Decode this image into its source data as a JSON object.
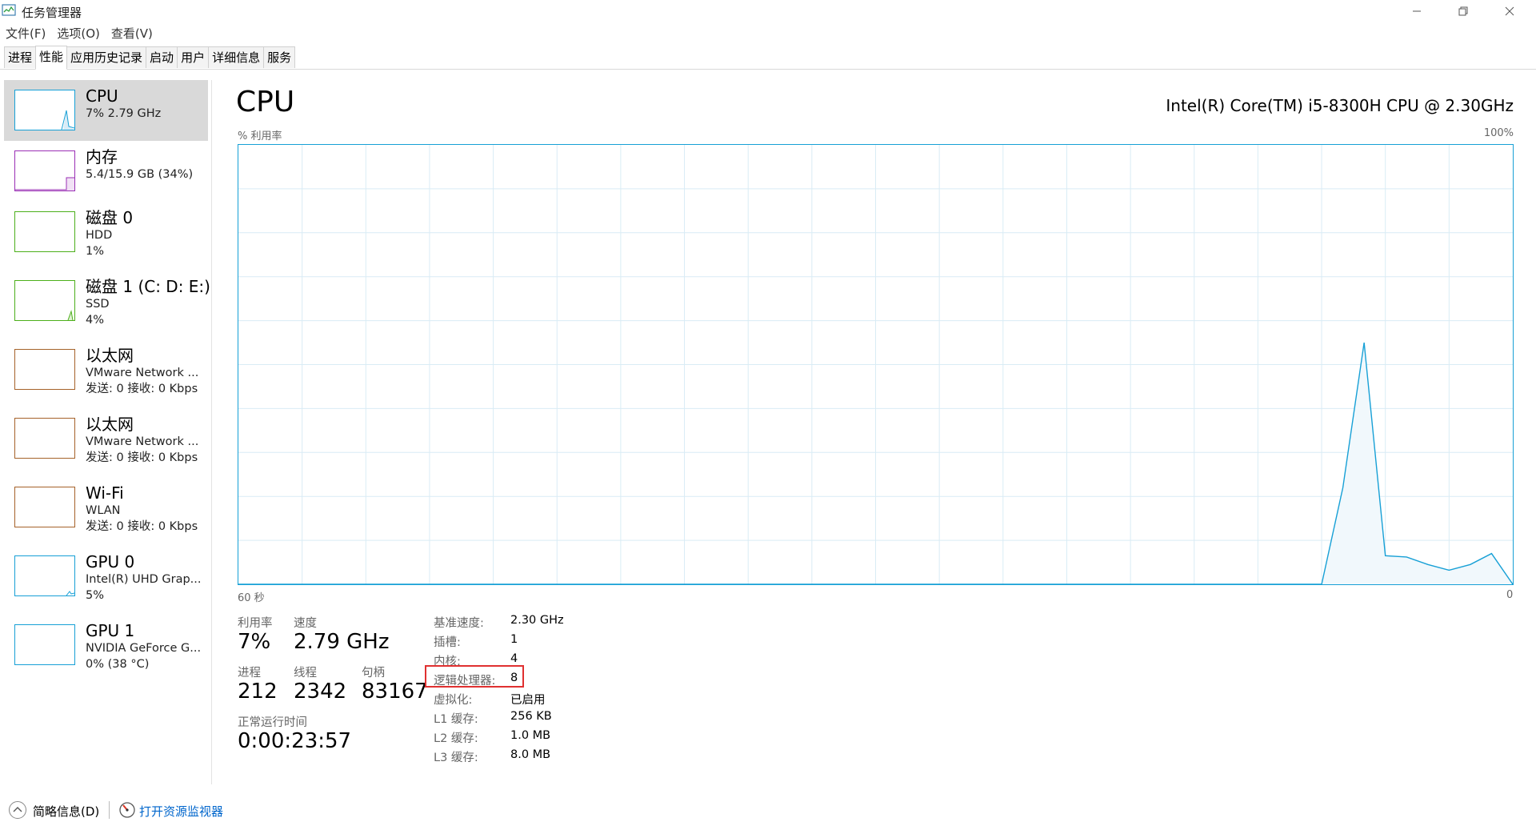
{
  "window": {
    "title": "任务管理器"
  },
  "menu": [
    "文件(F)",
    "选项(O)",
    "查看(V)"
  ],
  "tabs": [
    "进程",
    "性能",
    "应用历史记录",
    "启动",
    "用户",
    "详细信息",
    "服务"
  ],
  "active_tab": "性能",
  "sidebar": {
    "items": [
      {
        "title": "CPU",
        "lines": [
          "7% 2.79 GHz"
        ],
        "color": "#17a0d6",
        "active": true
      },
      {
        "title": "内存",
        "lines": [
          "5.4/15.9 GB (34%)"
        ],
        "color": "#9a2fb5"
      },
      {
        "title": "磁盘 0",
        "lines": [
          "HDD",
          "1%"
        ],
        "color": "#4caf1a"
      },
      {
        "title": "磁盘 1 (C: D: E:)",
        "lines": [
          "SSD",
          "4%"
        ],
        "color": "#4caf1a"
      },
      {
        "title": "以太网",
        "lines": [
          "VMware Network ...",
          "发送: 0 接收: 0 Kbps"
        ],
        "color": "#a5622a"
      },
      {
        "title": "以太网",
        "lines": [
          "VMware Network ...",
          "发送: 0 接收: 0 Kbps"
        ],
        "color": "#a5622a"
      },
      {
        "title": "Wi-Fi",
        "lines": [
          "WLAN",
          "发送: 0 接收: 0 Kbps"
        ],
        "color": "#a5622a"
      },
      {
        "title": "GPU 0",
        "lines": [
          "Intel(R) UHD Grap...",
          "5%"
        ],
        "color": "#17a0d6"
      },
      {
        "title": "GPU 1",
        "lines": [
          "NVIDIA GeForce G...",
          "0% (38 °C)"
        ],
        "color": "#17a0d6"
      }
    ]
  },
  "main": {
    "title": "CPU",
    "model": "Intel(R) Core(TM) i5-8300H CPU @ 2.30GHz",
    "y_label": "% 利用率",
    "y_max_label": "100%",
    "x_left_label": "60 秒",
    "x_right_label": "0"
  },
  "chart_data": {
    "type": "area",
    "x": [
      60,
      3,
      2,
      1,
      0
    ],
    "values": [
      0,
      0,
      0,
      0,
      0
    ],
    "series": [
      {
        "x": [
          60,
          10,
          9,
          8,
          7,
          6,
          5,
          4,
          3,
          2,
          1,
          0
        ],
        "values": [
          0,
          0,
          0,
          22,
          55,
          6.5,
          6.2,
          4.5,
          3.2,
          4.5,
          7,
          0
        ]
      }
    ],
    "ylim": [
      0,
      100
    ],
    "xlim": [
      60,
      0
    ],
    "grid": true,
    "color": "#17a0d6"
  },
  "stats": {
    "utilization_label": "利用率",
    "utilization": "7%",
    "speed_label": "速度",
    "speed": "2.79 GHz",
    "processes_label": "进程",
    "processes": "212",
    "threads_label": "线程",
    "threads": "2342",
    "handles_label": "句柄",
    "handles": "83167",
    "uptime_label": "正常运行时间",
    "uptime": "0:00:23:57"
  },
  "details": [
    {
      "key": "基准速度:",
      "value": "2.30 GHz"
    },
    {
      "key": "插槽:",
      "value": "1"
    },
    {
      "key": "内核:",
      "value": "4"
    },
    {
      "key": "逻辑处理器:",
      "value": "8"
    },
    {
      "key": "虚拟化:",
      "value": "已启用"
    },
    {
      "key": "L1 缓存:",
      "value": "256 KB"
    },
    {
      "key": "L2 缓存:",
      "value": "1.0 MB"
    },
    {
      "key": "L3 缓存:",
      "value": "8.0 MB"
    }
  ],
  "footer": {
    "summary": "简略信息(D)",
    "resource_monitor": "打开资源监视器",
    "icons": [
      "chevron-up-icon",
      "resource-monitor-icon"
    ]
  }
}
